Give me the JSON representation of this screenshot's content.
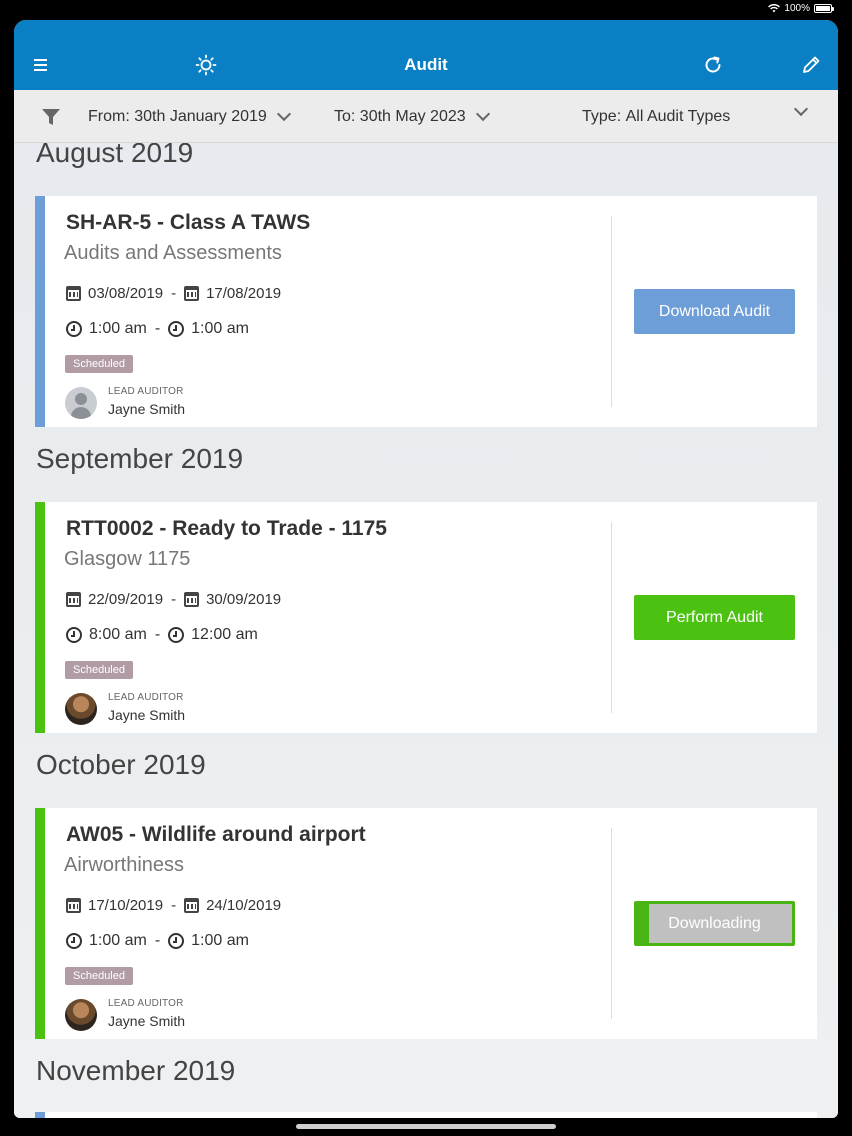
{
  "status": {
    "battery": "100%"
  },
  "header": {
    "title": "Audit"
  },
  "filters": {
    "from_label": "From:",
    "from_value": "30th January 2019",
    "to_label": "To:",
    "to_value": "30th May 2023",
    "type_label": "Type:",
    "type_value": "All Audit Types"
  },
  "months": [
    "August 2019",
    "September 2019",
    "October 2019",
    "November 2019"
  ],
  "audits": [
    {
      "title": "SH-AR-5 - Class A TAWS",
      "subtitle": "Audits and Assessments",
      "start_date": "03/08/2019",
      "end_date": "17/08/2019",
      "start_time": "1:00 am",
      "end_time": "1:00 am",
      "status": "Scheduled",
      "lead_label": "LEAD AUDITOR",
      "lead_name": "Jayne Smith",
      "action": "Download Audit",
      "accent_color": "#6e9ed8"
    },
    {
      "title": "RTT0002 - Ready to Trade - 1175",
      "subtitle": "Glasgow 1175",
      "start_date": "22/09/2019",
      "end_date": "30/09/2019",
      "start_time": "8:00 am",
      "end_time": "12:00 am",
      "status": "Scheduled",
      "lead_label": "LEAD AUDITOR",
      "lead_name": "Jayne Smith",
      "action": "Perform Audit",
      "accent_color": "#4bc211"
    },
    {
      "title": "AW05 - Wildlife around airport",
      "subtitle": "Airworthiness",
      "start_date": "17/10/2019",
      "end_date": "24/10/2019",
      "start_time": "1:00 am",
      "end_time": "1:00 am",
      "status": "Scheduled",
      "lead_label": "LEAD AUDITOR",
      "lead_name": "Jayne Smith",
      "action": "Downloading",
      "action_progress": 0.08,
      "accent_color": "#4bc211"
    }
  ],
  "date_separator": "-",
  "colors": {
    "header": "#0b7fc4",
    "download": "#6e9ed8",
    "perform": "#4bc211",
    "badge": "#b19ba5"
  }
}
